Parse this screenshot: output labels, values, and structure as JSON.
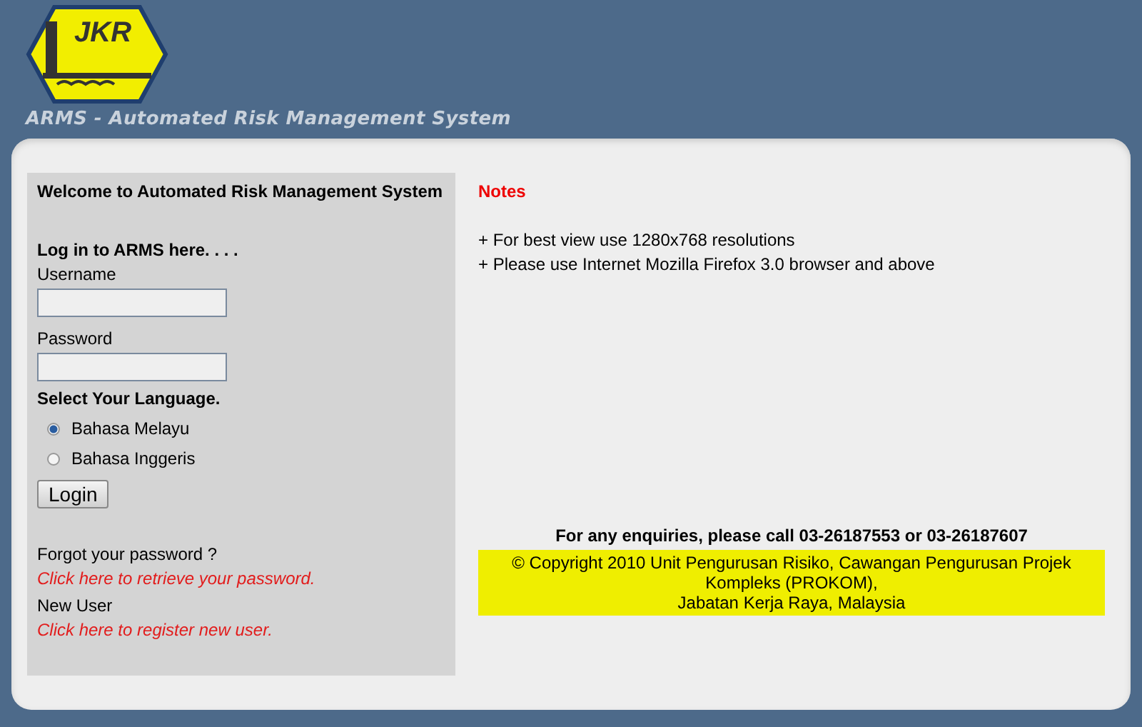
{
  "header": {
    "logo_text": "JKR",
    "subtitle": "ARMS - Automated Risk Management System"
  },
  "login": {
    "welcome": "Welcome to Automated Risk Management System",
    "heading": "Log in to ARMS here. . . .",
    "fields": [
      {
        "label": "Username"
      },
      {
        "label": "Password"
      }
    ],
    "language_heading": "Select Your Language.",
    "languages": [
      {
        "label": "Bahasa Melayu",
        "selected": true
      },
      {
        "label": "Bahasa Inggeris",
        "selected": false
      }
    ],
    "button": "Login",
    "forgot_label": "Forgot your password ?",
    "forgot_link": "Click here to retrieve your password.",
    "new_user_label": "New User",
    "register_link": "Click here to register new user."
  },
  "notes": {
    "title": "Notes",
    "items": [
      "+ For best view use 1280x768 resolutions",
      "+ Please use Internet Mozilla Firefox 3.0 browser and above"
    ]
  },
  "footer": {
    "enquiries": "For any enquiries, please call 03-26187553 or 03-26187607",
    "copyright_lines": [
      "© Copyright 2010 Unit Pengurusan Risiko, Cawangan Pengurusan Projek Kompleks (PROKOM),",
      "Jabatan Kerja Raya, Malaysia"
    ]
  }
}
